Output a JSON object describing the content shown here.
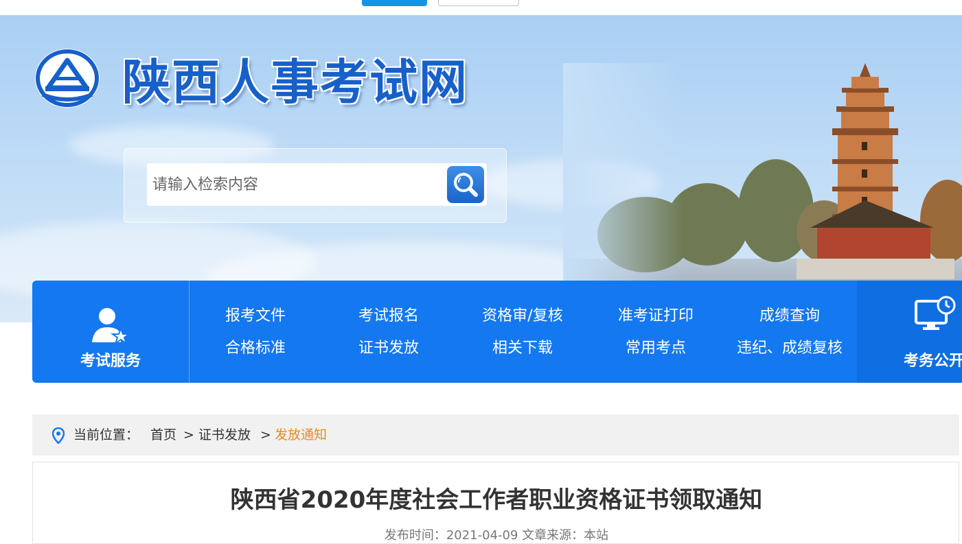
{
  "site": {
    "title": "陕西人事考试网"
  },
  "search": {
    "placeholder": "请输入检索内容"
  },
  "nav": {
    "service_label": "考试服务",
    "links": [
      {
        "label": "报考文件"
      },
      {
        "label": "考试报名"
      },
      {
        "label": "资格审/复核"
      },
      {
        "label": "准考证打印"
      },
      {
        "label": "成绩查询"
      },
      {
        "label": "合格标准"
      },
      {
        "label": "证书发放"
      },
      {
        "label": "相关下载"
      },
      {
        "label": "常用考点"
      },
      {
        "label": "违纪、成绩复核"
      }
    ],
    "public_label": "考务公开"
  },
  "breadcrumb": {
    "prefix": "当前位置：",
    "items": [
      {
        "label": "首页"
      },
      {
        "label": "证书发放"
      }
    ],
    "separator": ">",
    "current": "发放通知"
  },
  "article": {
    "title": "陕西省2020年度社会工作者职业资格证书领取通知",
    "meta": "发布时间：2021-04-09    文章来源：本站"
  },
  "colors": {
    "nav_blue": "#1478f0",
    "title_blue": "#1760c9",
    "breadcrumb_current": "#e88b1f"
  }
}
